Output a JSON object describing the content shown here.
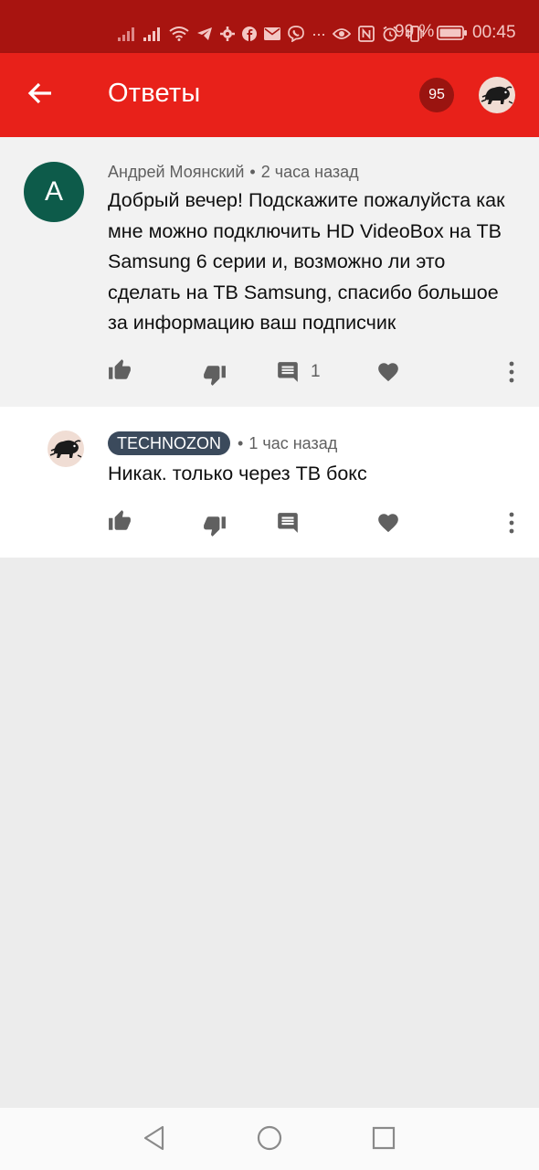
{
  "status_bar": {
    "battery_percent": "99 %",
    "time": "00:45",
    "icons": [
      "signal-icon",
      "signal-icon",
      "wifi-icon",
      "telegram-icon",
      "settings-icon",
      "facebook-icon",
      "mail-icon",
      "viber-icon",
      "more-dots-icon",
      "eye-icon",
      "nfc-icon",
      "alarm-icon",
      "vibrate-icon",
      "battery-icon"
    ]
  },
  "app_bar": {
    "title": "Ответы",
    "badge_count": "95",
    "background": "#e8211a"
  },
  "comment": {
    "author": "Андрей Моянский",
    "avatar_letter": "А",
    "time": "2 часа назад",
    "text": "Добрый вечер! Подскажите пожалуйста как мне можно подключить HD VideoBox на ТВ Samsung 6 серии и, возможно ли это сделать на ТВ Samsung, спасибо большое за информацию ваш подписчик",
    "reply_count": "1"
  },
  "reply": {
    "author": "TECHNOZON",
    "time": "1 час назад",
    "text": "Никак. только через ТВ бокс"
  },
  "separator": "•",
  "colors": {
    "status_bar": "#a81410",
    "app_bar": "#e8211a",
    "badge": "#9a1410",
    "avatar": "#0d5b4a",
    "author_chip": "#3b4a5c",
    "icon": "#606060"
  }
}
